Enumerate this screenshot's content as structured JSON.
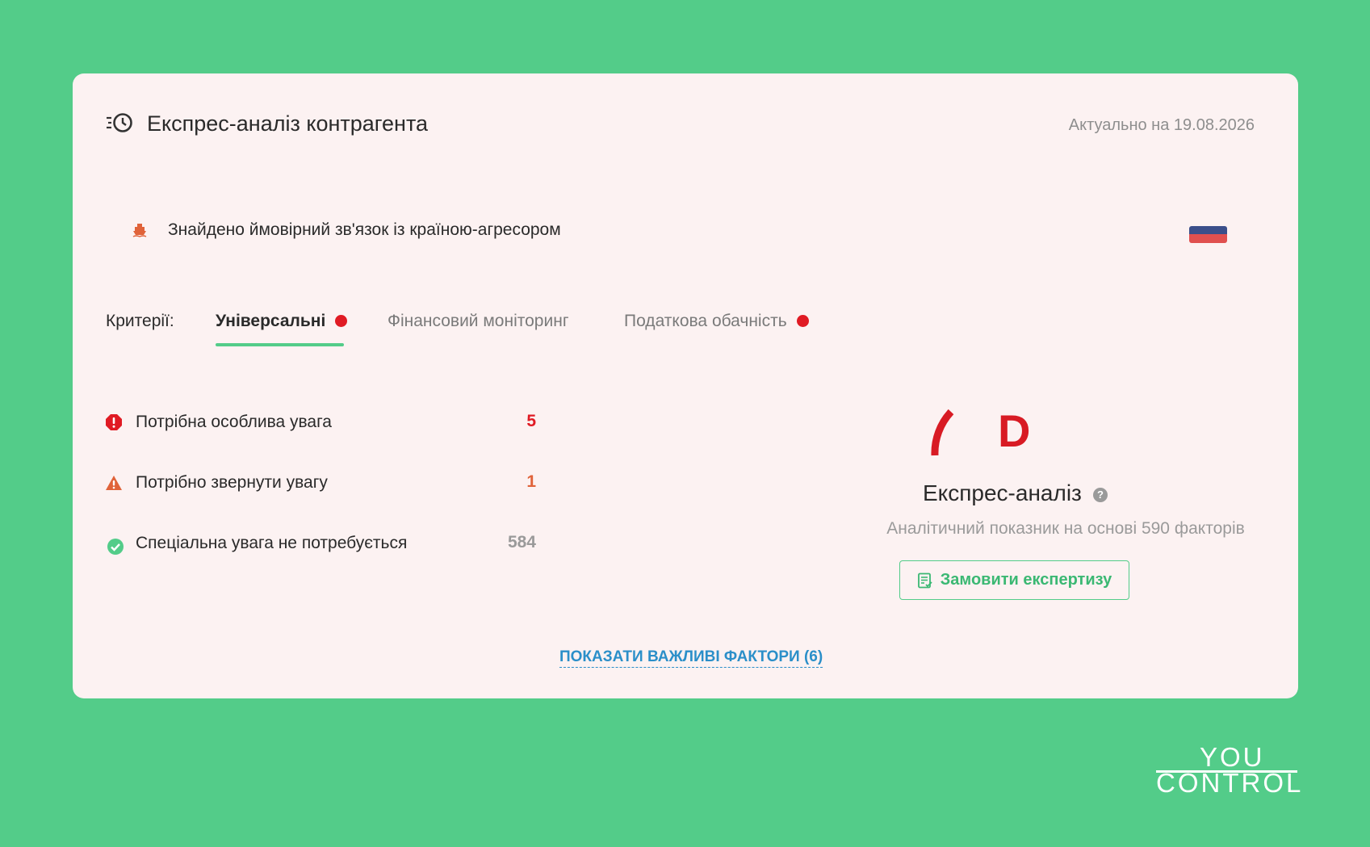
{
  "header": {
    "title": "Експрес-аналіз контрагента",
    "date_text": "Актуально на 19.08.2026"
  },
  "alert": {
    "text": "Знайдено ймовірний зв'язок із країною-агресором"
  },
  "criteria": {
    "label": "Критерії:",
    "tabs": [
      {
        "label": "Універсальні",
        "active": true,
        "flag": true
      },
      {
        "label": "Фінансовий моніторинг",
        "active": false,
        "flag": false
      },
      {
        "label": "Податкова обачність",
        "active": false,
        "flag": true
      }
    ]
  },
  "stats": [
    {
      "label": "Потрібна особлива увага",
      "value": "5"
    },
    {
      "label": "Потрібно звернути увагу",
      "value": "1"
    },
    {
      "label": "Спеціальна увага не потребується",
      "value": "584"
    }
  ],
  "express": {
    "grade": "D",
    "title": "Експрес-аналіз",
    "help": "?",
    "subtitle": "Аналітичний показник на основі 590 факторів",
    "order_label": "Замовити експертизу"
  },
  "footer": {
    "show_factors": "ПОКАЗАТИ ВАЖЛИВІ ФАКТОРИ (6)"
  },
  "logo": {
    "line1": "YOU",
    "line2": "CONTROL"
  },
  "colors": {
    "background": "#53cc89",
    "card": "#fcf2f2",
    "danger": "#e01b24",
    "warning": "#e0633a",
    "success": "#53cc89",
    "link": "#2b8fc9"
  }
}
